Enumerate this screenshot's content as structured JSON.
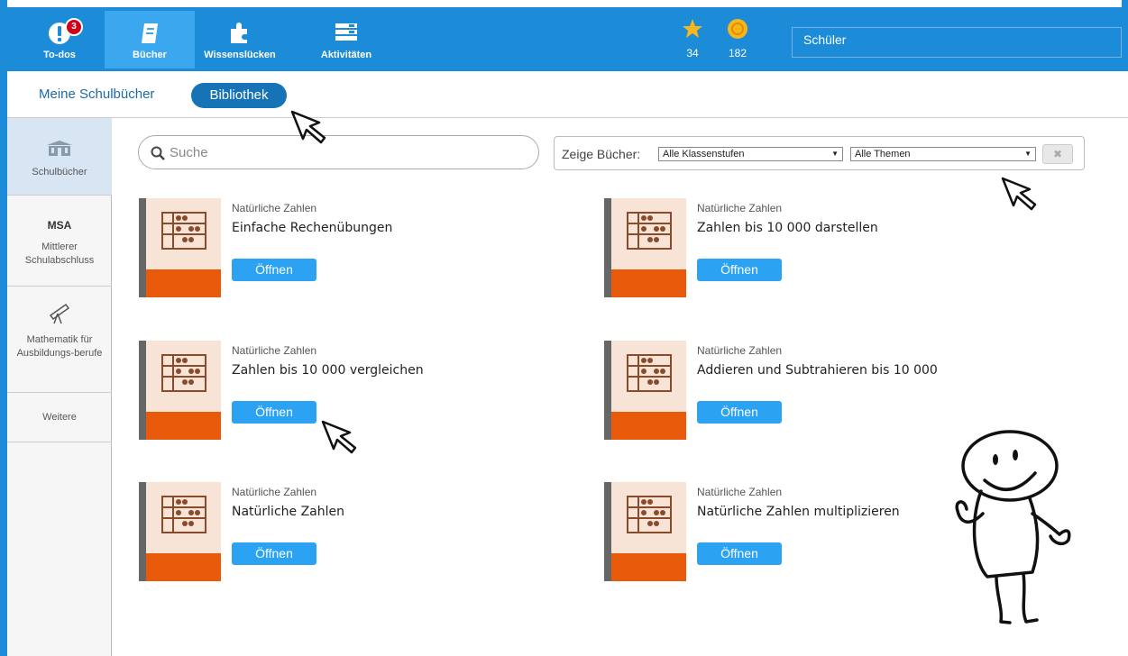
{
  "topnav": {
    "items": [
      {
        "label": "To-dos",
        "icon": "exclamation-icon",
        "badge": "3"
      },
      {
        "label": "Bücher",
        "icon": "book-icon"
      },
      {
        "label": "Wissenslücken",
        "icon": "puzzle-icon"
      },
      {
        "label": "Aktivitäten",
        "icon": "list-icon"
      }
    ],
    "stars": "34",
    "coins": "182",
    "user": "Schüler"
  },
  "subnav": {
    "link": "Meine Schulbücher",
    "active": "Bibliothek"
  },
  "sidebar": {
    "items": [
      {
        "label": "Schulbücher",
        "icon": "school-icon"
      },
      {
        "title": "MSA",
        "label": "Mittlerer Schulabschluss"
      },
      {
        "label": "Mathematik für Ausbildungs-berufe",
        "icon": "telescope-icon"
      },
      {
        "label": "Weitere"
      }
    ]
  },
  "search": {
    "placeholder": "Suche"
  },
  "filter": {
    "label": "Zeige Bücher:",
    "grade": "Alle Klassenstufen",
    "topic": "Alle Themen",
    "clear": "✖"
  },
  "books": [
    {
      "category": "Natürliche Zahlen",
      "title": "Einfache Rechenübungen",
      "button": "Öffnen"
    },
    {
      "category": "Natürliche Zahlen",
      "title": "Zahlen bis 10 000 darstellen",
      "button": "Öffnen"
    },
    {
      "category": "Natürliche Zahlen",
      "title": "Zahlen bis 10 000 vergleichen",
      "button": "Öffnen"
    },
    {
      "category": "Natürliche Zahlen",
      "title": "Addieren und Subtrahieren bis 10 000",
      "button": "Öffnen"
    },
    {
      "category": "Natürliche Zahlen",
      "title": "Natürliche Zahlen",
      "button": "Öffnen"
    },
    {
      "category": "Natürliche Zahlen",
      "title": "Natürliche Zahlen multiplizieren",
      "button": "Öffnen"
    }
  ],
  "colors": {
    "topbar": "#1c8cd9",
    "active_tab": "#3ba7ef",
    "button": "#2ba3f2",
    "cover": "#f7e4d7",
    "cover_band": "#e85a0a"
  }
}
